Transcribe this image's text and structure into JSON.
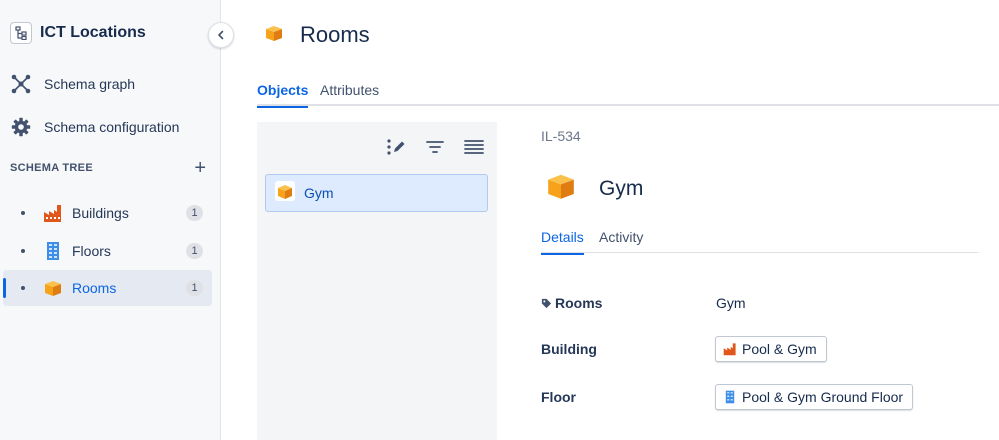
{
  "sidebar": {
    "title": "ICT Locations",
    "nav": [
      {
        "label": "Schema graph",
        "icon": "schema-graph-icon"
      },
      {
        "label": "Schema configuration",
        "icon": "gear-icon"
      }
    ],
    "tree_header": "SCHEMA TREE",
    "tree": [
      {
        "label": "Buildings",
        "count": "1",
        "icon": "factory-icon"
      },
      {
        "label": "Floors",
        "count": "1",
        "icon": "building-icon"
      },
      {
        "label": "Rooms",
        "count": "1",
        "icon": "box-icon",
        "active": true
      }
    ]
  },
  "main": {
    "title": "Rooms",
    "tabs": [
      {
        "label": "Objects",
        "active": true
      },
      {
        "label": "Attributes",
        "active": false
      }
    ],
    "list": {
      "items": [
        {
          "label": "Gym",
          "selected": true
        }
      ]
    },
    "detail": {
      "key": "IL-534",
      "name": "Gym",
      "tabs": [
        {
          "label": "Details",
          "active": true
        },
        {
          "label": "Activity",
          "active": false
        }
      ],
      "attributes": [
        {
          "name": "Rooms",
          "value": "Gym"
        },
        {
          "name": "Building",
          "value": "Pool & Gym"
        },
        {
          "name": "Floor",
          "value": "Pool & Gym Ground Floor"
        }
      ]
    }
  },
  "colors": {
    "accent": "#0c66e4",
    "box_orange": "#f7a21b",
    "factory_orange": "#e0561b",
    "floor_blue": "#3c8ee6"
  }
}
